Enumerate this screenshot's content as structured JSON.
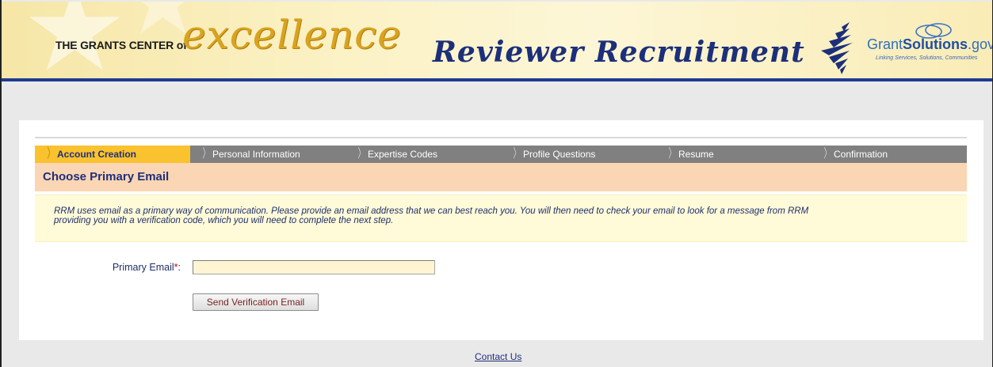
{
  "banner": {
    "brand_prefix": "THE GRANTS CENTER of",
    "brand_excellence": "excellence",
    "brand_title": "Reviewer Recruitment",
    "gs_name_plain": "Grant",
    "gs_name_bold": "Solutions",
    "gs_name_suffix": ".gov",
    "gs_tagline": "Linking Services, Solutions, Communities",
    "colors": {
      "blue_bar": "#1f3a93",
      "gold": "#d8a320"
    }
  },
  "steps": [
    {
      "label": "Account Creation",
      "active": true
    },
    {
      "label": "Personal Information",
      "active": false
    },
    {
      "label": "Expertise Codes",
      "active": false
    },
    {
      "label": "Profile Questions",
      "active": false
    },
    {
      "label": "Resume",
      "active": false
    },
    {
      "label": "Confirmation",
      "active": false
    }
  ],
  "section": {
    "title": "Choose Primary Email",
    "notice_line1": "RRM uses email as a primary way of communication. Please provide an email address that we can best reach you. You will then need to check your email to look for a message from RRM",
    "notice_line2": "providing you with a verification code, which you will need to complete the next step."
  },
  "form": {
    "email_label": "Primary Email",
    "required_mark": "*",
    "label_colon": ":",
    "email_value": "",
    "send_button": "Send Verification Email"
  },
  "footer": {
    "contact_link": "Contact Us"
  }
}
